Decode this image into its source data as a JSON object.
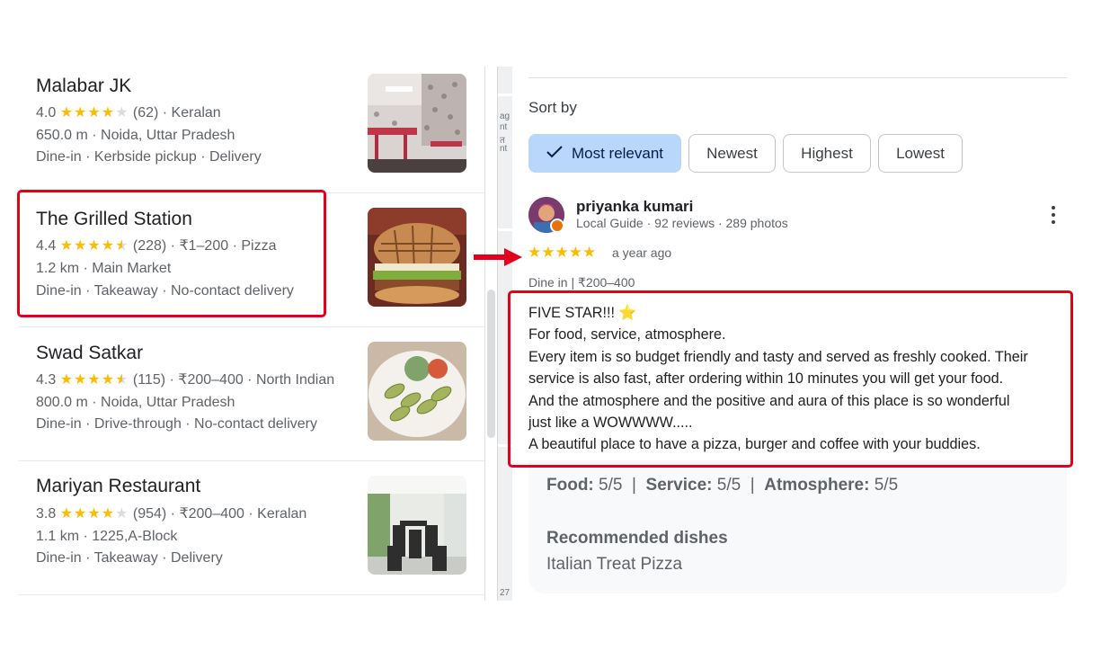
{
  "results": [
    {
      "name": "Malabar JK",
      "rating": "4.0",
      "stars": 4,
      "review_count": "(62)",
      "meta": " · Keralan",
      "location": "650.0 m · Noida, Uttar Pradesh",
      "services": "Dine-in · Kerbside pickup · Delivery"
    },
    {
      "name": "The Grilled Station",
      "rating": "4.4",
      "stars": 4.5,
      "review_count": "(228)",
      "meta": " · ₹1–200 · Pizza",
      "location": "1.2 km · Main Market",
      "services": "Dine-in · Takeaway · No-contact delivery"
    },
    {
      "name": "Swad Satkar",
      "rating": "4.3",
      "stars": 4.5,
      "review_count": "(115)",
      "meta": " · ₹200–400 · North Indian",
      "location": "800.0 m · Noida, Uttar Pradesh",
      "services": "Dine-in · Drive-through · No-contact delivery"
    },
    {
      "name": "Mariyan Restaurant",
      "rating": "3.8",
      "stars": 4,
      "review_count": "(954)",
      "meta": " · ₹200–400 · Keralan",
      "location": "1.1 km · 1225,A-Block",
      "services": "Dine-in · Takeaway · Delivery"
    }
  ],
  "sort": {
    "label": "Sort by",
    "chips": [
      "Most relevant",
      "Newest",
      "Highest",
      "Lowest"
    ],
    "active": "Most relevant"
  },
  "review": {
    "author": "priyanka kumari",
    "author_meta": "Local Guide · 92 reviews · 289 photos",
    "stars": "★★★★★",
    "time": "a year ago",
    "tags": "Dine in  |  ₹200–400",
    "text_lines": [
      "FIVE STAR!!! ⭐",
      "For food, service, atmosphere.",
      "Every item is so budget friendly and tasty and served as freshly cooked. Their",
      "service is also fast, after ordering within 10 minutes you will get your food.",
      "And the atmosphere and the positive and aura of this place is so wonderful",
      "just like a WOWWWW.....",
      "A beautiful place to have a pizza, burger and coffee with your buddies."
    ],
    "ratings": {
      "food_label": "Food:",
      "food_value": "5/5",
      "service_label": "Service:",
      "service_value": "5/5",
      "atmosphere_label": "Atmosphere:",
      "atmosphere_value": "5/5",
      "separator": "|"
    },
    "recommended_title": "Recommended dishes",
    "recommended_value": "Italian Treat Pizza"
  },
  "map_labels": [
    "ag",
    "nt",
    "त",
    "nt",
    "27"
  ],
  "colors": {
    "star": "#fbbc04",
    "highlight": "#e3001b",
    "active_chip": "#b9d6fb"
  }
}
